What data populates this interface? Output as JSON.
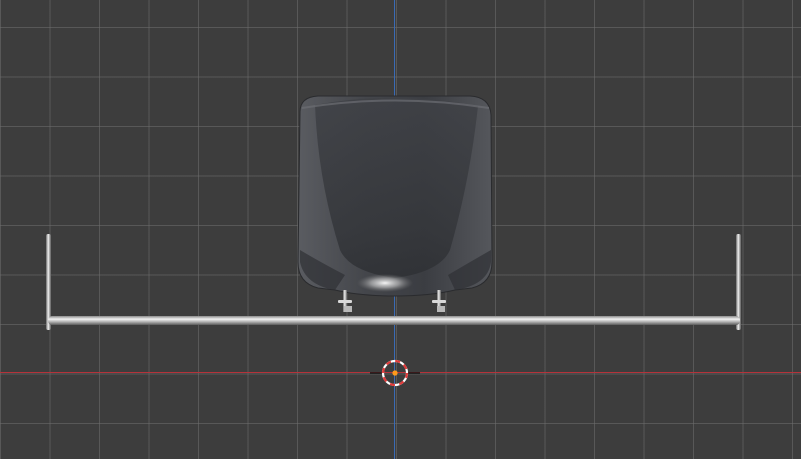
{
  "app": {
    "name": "3D Viewport"
  },
  "viewport": {
    "background": "#3d3d3d",
    "grid_color": "#6e6e6e",
    "axis_x_color": "#b5323a",
    "axis_z_color": "#3a6bb5"
  },
  "objects": [
    {
      "name": "seat-shell",
      "icon": "none"
    },
    {
      "name": "seat-rail-bar",
      "icon": "none"
    },
    {
      "name": "left-rail-post",
      "icon": "none"
    },
    {
      "name": "right-rail-post",
      "icon": "none"
    },
    {
      "name": "mounting-bracket-left",
      "icon": "none"
    },
    {
      "name": "mounting-bracket-right",
      "icon": "none"
    }
  ],
  "cursor": {
    "icon": "3d-cursor-icon",
    "colors": [
      "#e03a3a",
      "#ffffff"
    ],
    "center_color": "#ff9a1a"
  }
}
